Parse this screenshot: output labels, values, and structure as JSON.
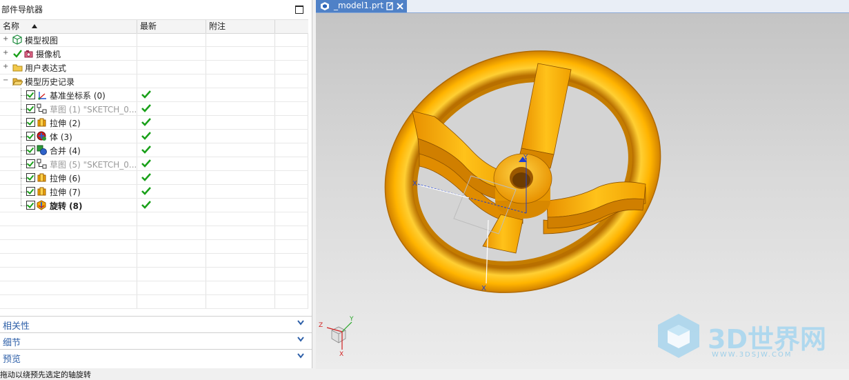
{
  "navigator": {
    "title": "部件导航器",
    "columns": {
      "name": "名称",
      "latest": "最新",
      "note": "附注"
    },
    "nodes": [
      {
        "label": "模型视图",
        "icon": "model-views-icon"
      },
      {
        "label": "摄像机",
        "icon": "camera-icon"
      },
      {
        "label": "用户表达式",
        "icon": "folder-icon"
      },
      {
        "label": "模型历史记录",
        "icon": "open-folder-icon"
      }
    ],
    "history": [
      {
        "label": "基准坐标系 (0)",
        "icon": "datum-csys-icon",
        "dim": false,
        "bold": false,
        "latest": true
      },
      {
        "label": "草图 (1) \"SKETCH_0...",
        "icon": "sketch-icon",
        "dim": true,
        "bold": false,
        "latest": true
      },
      {
        "label": "拉伸 (2)",
        "icon": "extrude-icon",
        "dim": false,
        "bold": false,
        "latest": true
      },
      {
        "label": "体 (3)",
        "icon": "body-icon",
        "dim": false,
        "bold": false,
        "latest": true
      },
      {
        "label": "合并 (4)",
        "icon": "unite-icon",
        "dim": false,
        "bold": false,
        "latest": true
      },
      {
        "label": "草图 (5) \"SKETCH_0...",
        "icon": "sketch-icon",
        "dim": true,
        "bold": false,
        "latest": true
      },
      {
        "label": "拉伸 (6)",
        "icon": "extrude-icon",
        "dim": false,
        "bold": false,
        "latest": true
      },
      {
        "label": "拉伸 (7)",
        "icon": "extrude-icon",
        "dim": false,
        "bold": false,
        "latest": true
      },
      {
        "label": "旋转 (8)",
        "icon": "revolve-icon",
        "dim": false,
        "bold": true,
        "latest": true
      }
    ],
    "sections": [
      "相关性",
      "细节",
      "预览"
    ]
  },
  "tab": {
    "label": "_model1.prt"
  },
  "status": "拖动以绕预先选定的轴旋转",
  "watermark": {
    "brand": "3D世界网",
    "url": "WWW.3DSJW.COM"
  },
  "colors": {
    "accent": "#4f81c7",
    "model": "#f5a800",
    "check": "#19a019",
    "section_text": "#2d5fa8"
  },
  "axes": {
    "x": "X",
    "y": "Y",
    "z": "Z"
  }
}
